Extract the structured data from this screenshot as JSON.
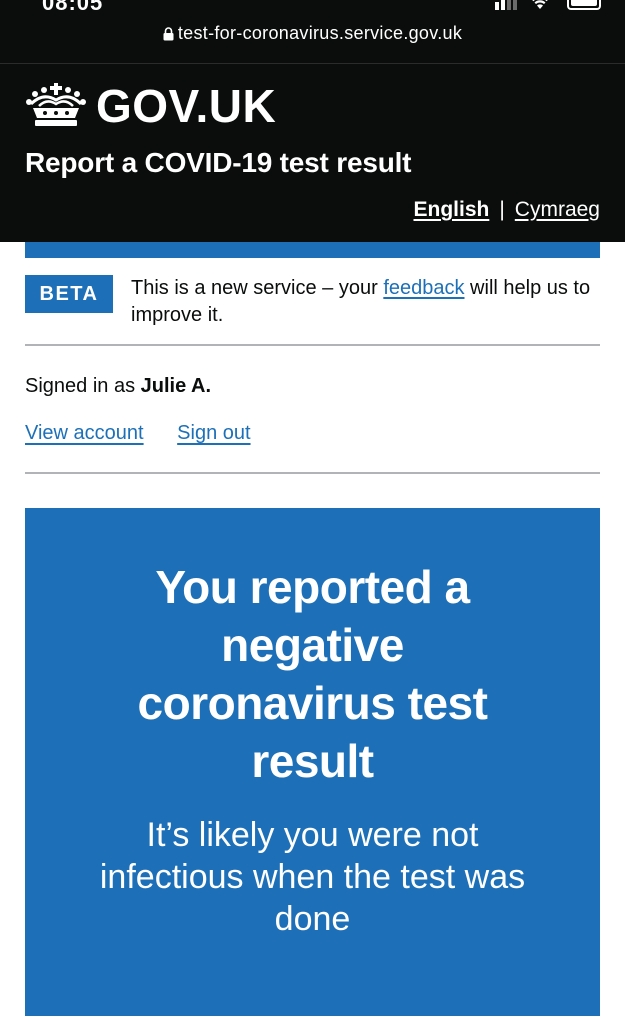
{
  "status_bar": {
    "time": "08:05"
  },
  "browser": {
    "url": "test-for-coronavirus.service.gov.uk"
  },
  "header": {
    "logotype": "GOV.UK",
    "service_name": "Report a COVID-19 test result",
    "lang_english": "English",
    "lang_separator": "|",
    "lang_cymraeg": "Cymraeg"
  },
  "phase_banner": {
    "tag": "BETA",
    "text_before": "This is a new service – your ",
    "link": "feedback",
    "text_after": " will help us to improve it."
  },
  "account": {
    "signed_in_prefix": "Signed in as ",
    "user_name": "Julie A.",
    "view_account": "View account",
    "sign_out": "Sign out"
  },
  "result_panel": {
    "title": "You reported a negative coronavirus test result",
    "body": "It’s likely you were not infectious when the test was done"
  },
  "colors": {
    "header_background": "#0b0c0c",
    "brand_blue": "#1d70b8",
    "divider_grey": "#b1b4b6",
    "text": "#0b0c0c"
  }
}
